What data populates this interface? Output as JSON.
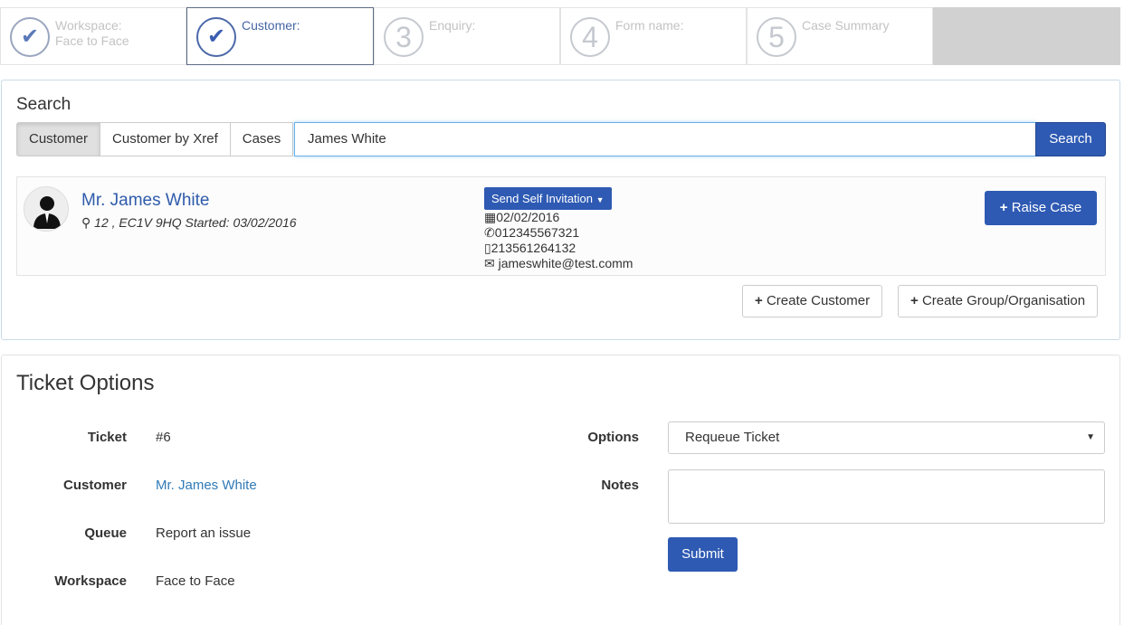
{
  "stepper": {
    "steps": [
      {
        "number": "✔",
        "label_line1": "Workspace:",
        "label_line2": "Face to Face"
      },
      {
        "number": "✔",
        "label_line1": "Customer:",
        "label_line2": ""
      },
      {
        "number": "3",
        "label_line1": "Enquiry:",
        "label_line2": ""
      },
      {
        "number": "4",
        "label_line1": "Form name:",
        "label_line2": ""
      },
      {
        "number": "5",
        "label_line1": "Case Summary",
        "label_line2": ""
      }
    ]
  },
  "search": {
    "title": "Search",
    "tabs": [
      "Customer",
      "Customer by Xref",
      "Cases"
    ],
    "query": "James White",
    "button": "Search"
  },
  "result": {
    "name": "Mr. James White",
    "address": "12 , EC1V 9HQ Started: 03/02/2016",
    "invite_button": "Send Self Invitation",
    "date": "02/02/2016",
    "phone": "012345567321",
    "mobile": "213561264132",
    "email": "jameswhite@test.comm",
    "raise_button": "Raise Case"
  },
  "actions": {
    "create_customer": "Create Customer",
    "create_group": "Create Group/Organisation"
  },
  "ticket": {
    "title": "Ticket Options",
    "fields": {
      "ticket_label": "Ticket",
      "ticket_value": "#6",
      "customer_label": "Customer",
      "customer_value": "Mr. James White",
      "queue_label": "Queue",
      "queue_value": "Report an issue",
      "workspace_label": "Workspace",
      "workspace_value": "Face to Face"
    },
    "options_label": "Options",
    "options_value": "Requeue Ticket",
    "notes_label": "Notes",
    "submit": "Submit"
  },
  "colors": {
    "primary": "#2e5ab3",
    "link": "#2f7ab8"
  }
}
